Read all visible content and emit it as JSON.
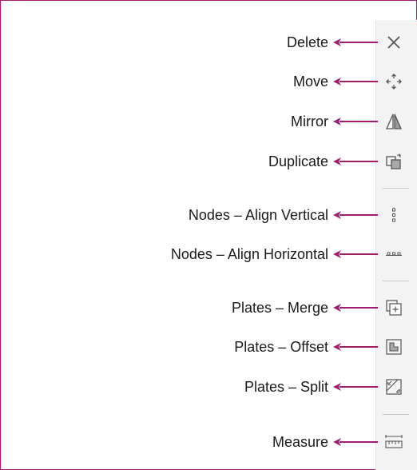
{
  "colors": {
    "accent": "#a01a6e",
    "toolbar_bg": "#f3f3f3",
    "icon": "#555555"
  },
  "tools": [
    {
      "label": "Delete",
      "icon": "close-icon"
    },
    {
      "label": "Move",
      "icon": "move-icon"
    },
    {
      "label": "Mirror",
      "icon": "mirror-icon"
    },
    {
      "label": "Duplicate",
      "icon": "duplicate-icon"
    },
    {
      "label": "Nodes – Align Vertical",
      "icon": "align-vertical-icon"
    },
    {
      "label": "Nodes – Align Horizontal",
      "icon": "align-horizontal-icon"
    },
    {
      "label": "Plates – Merge",
      "icon": "merge-icon"
    },
    {
      "label": "Plates – Offset",
      "icon": "offset-icon"
    },
    {
      "label": "Plates – Split",
      "icon": "split-icon"
    },
    {
      "label": "Measure",
      "icon": "measure-icon"
    }
  ]
}
